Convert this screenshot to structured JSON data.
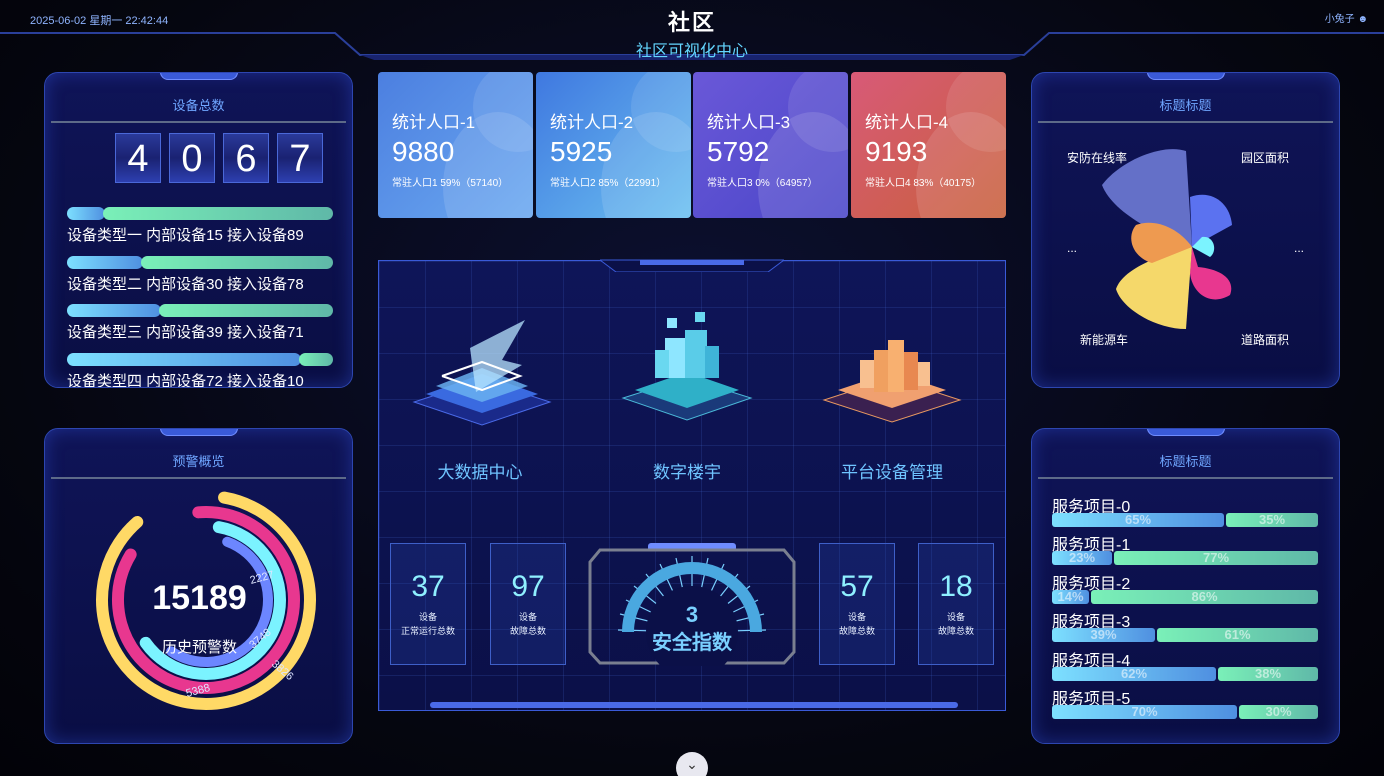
{
  "header": {
    "datetime": "2025-06-02 星期一 22:42:44",
    "title": "社区",
    "subtitle": "社区可视化中心",
    "user": "小兔子"
  },
  "device_total": {
    "title": "设备总数",
    "digits": [
      "4",
      "0",
      "6",
      "7"
    ],
    "types": [
      {
        "label": "设备类型一   内部设备15 接入设备89",
        "internal": 15,
        "access": 89
      },
      {
        "label": "设备类型二   内部设备30 接入设备78",
        "internal": 30,
        "access": 78
      },
      {
        "label": "设备类型三   内部设备39 接入设备71",
        "internal": 39,
        "access": 71
      },
      {
        "label": "设备类型四   内部设备72 接入设备10",
        "internal": 72,
        "access": 10
      }
    ]
  },
  "warning": {
    "title": "预警概览",
    "total": "15189",
    "total_label": "历史预警数",
    "ring_labels": [
      "2227",
      "3748",
      "3826",
      "5388"
    ],
    "colors": [
      "#ffd966",
      "#e8378f",
      "#7bf3ff",
      "#6c86ff"
    ]
  },
  "stats": [
    {
      "title": "统计人口-1",
      "value": "9880",
      "sub": "常驻人口1 59%（57140）",
      "grad": [
        "#4c7fe0",
        "#6aa8f0"
      ]
    },
    {
      "title": "统计人口-2",
      "value": "5925",
      "sub": "常驻人口2 85%（22991）",
      "grad": [
        "#3f78e0",
        "#6bc0f0"
      ]
    },
    {
      "title": "统计人口-3",
      "value": "5792",
      "sub": "常驻人口3 0%（64957）",
      "grad": [
        "#6a58d8",
        "#4a46c8"
      ]
    },
    {
      "title": "统计人口-4",
      "value": "9193",
      "sub": "常驻人口4 83%（40175）",
      "grad": [
        "#d85a78",
        "#c8603a"
      ]
    }
  ],
  "center": {
    "features": [
      "大数据中心",
      "数字楼宇",
      "平台设备管理"
    ],
    "minis": [
      {
        "value": "37",
        "line1": "设备",
        "line2": "正常运行总数"
      },
      {
        "value": "97",
        "line1": "设备",
        "line2": "故障总数"
      },
      {
        "value": "57",
        "line1": "设备",
        "line2": "故障总数"
      },
      {
        "value": "18",
        "line1": "设备",
        "line2": "故障总数"
      }
    ],
    "safety_value": "3",
    "safety_label": "安全指数"
  },
  "rose": {
    "title": "标题标题",
    "labels": {
      "tl": "安防在线率",
      "tr": "园区面积",
      "bl": "新能源车",
      "br": "道路面积",
      "ml": "...",
      "mr": "..."
    },
    "colors": [
      "#6470c8",
      "#5b72f0",
      "#7bf3ff",
      "#e8378f",
      "#f5d86a",
      "#ee9a50"
    ]
  },
  "services": {
    "title": "标题标题",
    "items": [
      {
        "name": "服务项目-0",
        "a": 65,
        "b": 35,
        "a_label": "65%",
        "b_label": "35%"
      },
      {
        "name": "服务项目-1",
        "a": 23,
        "b": 77,
        "a_label": "23%",
        "b_label": "77%"
      },
      {
        "name": "服务项目-2",
        "a": 14,
        "b": 86,
        "a_label": "14%",
        "b_label": "86%"
      },
      {
        "name": "服务项目-3",
        "a": 39,
        "b": 61,
        "a_label": "39%",
        "b_label": "61%"
      },
      {
        "name": "服务项目-4",
        "a": 62,
        "b": 38,
        "a_label": "62%",
        "b_label": "38%"
      },
      {
        "name": "服务项目-5",
        "a": 70,
        "b": 30,
        "a_label": "70%",
        "b_label": "30%"
      }
    ]
  }
}
